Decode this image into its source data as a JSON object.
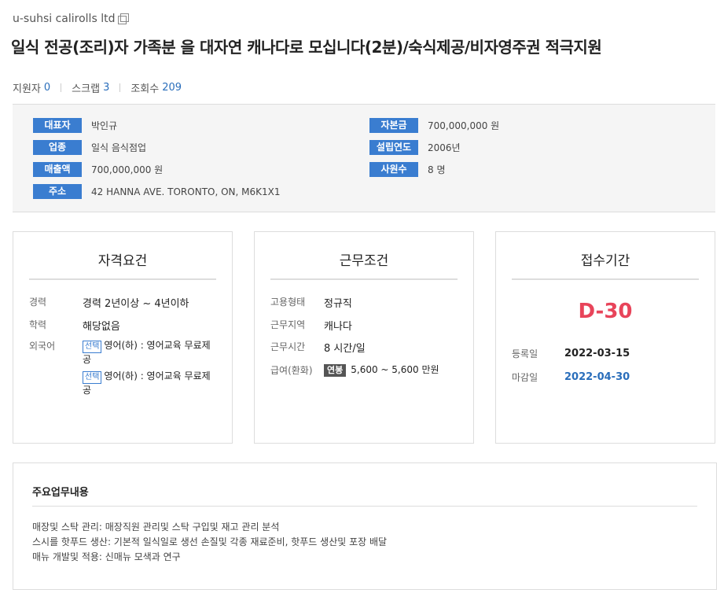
{
  "company": {
    "name": "u-suhsi calirolls ltd",
    "copy_icon": "copy-icon"
  },
  "title": "일식 전공(조리)자 가족분 을 대자연 캐나다로 모십니다(2분)/숙식제공/비자영주권 적극지원",
  "stats": [
    {
      "label": "지원자",
      "value": "0"
    },
    {
      "label": "스크랩",
      "value": "3"
    },
    {
      "label": "조회수",
      "value": "209"
    }
  ],
  "info": {
    "left": [
      {
        "label": "대표자",
        "value": "박인규"
      },
      {
        "label": "업종",
        "value": "일식 음식점업"
      },
      {
        "label": "매출액",
        "value": "700,000,000 원"
      },
      {
        "label": "주소",
        "value": "42 HANNA AVE. TORONTO, ON, M6K1X1"
      }
    ],
    "right": [
      {
        "label": "자본금",
        "value": "700,000,000 원"
      },
      {
        "label": "설립연도",
        "value": "2006년"
      },
      {
        "label": "사원수",
        "value": "8 명"
      }
    ]
  },
  "qualifications": {
    "title": "자격요건",
    "career": {
      "key": "경력",
      "value": "경력 2년이상 ~ 4년이하"
    },
    "education": {
      "key": "학력",
      "value": "해당없음"
    },
    "language": {
      "key": "외국어",
      "items": [
        {
          "tag": "선택",
          "text": "영어(하) : 영어교육 무료제공"
        },
        {
          "tag": "선택",
          "text": "영어(하) : 영어교육 무료제공"
        }
      ]
    }
  },
  "conditions": {
    "title": "근무조건",
    "employment": {
      "key": "고용형태",
      "value": "정규직"
    },
    "location": {
      "key": "근무지역",
      "value": "캐나다"
    },
    "hours": {
      "key": "근무시간",
      "value": "8 시간/일"
    },
    "salary": {
      "key": "급여(환화)",
      "pill": "연봉",
      "value": "5,600 ~ 5,600 만원"
    }
  },
  "period": {
    "title": "접수기간",
    "dday": "D-30",
    "registered": {
      "key": "등록일",
      "value": "2022-03-15"
    },
    "deadline": {
      "key": "마감일",
      "value": "2022-04-30"
    }
  },
  "duties": {
    "title": "주요업무내용",
    "lines": [
      "매장및 스탁 관리: 매장직원 관리및 스탁 구입및 재고 관리 분석",
      "스시를 핫푸드 생산: 기본적 일식일로 생선 손질및 각종 재료준비, 핫푸드 생산및 포장 배달",
      "매뉴 개발및 적용: 신매뉴 모색과 연구"
    ]
  },
  "colors": {
    "accent": "#3a7dd0",
    "link": "#2a6ebb",
    "dday": "#e8445a"
  }
}
